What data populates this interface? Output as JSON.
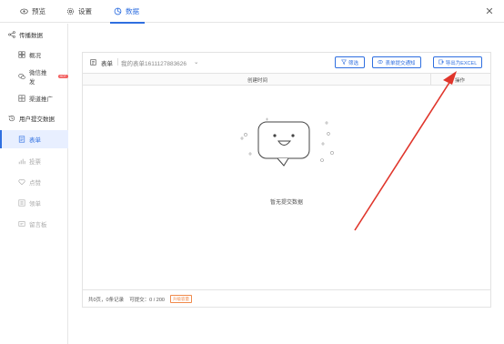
{
  "tabs": [
    {
      "label": "预览",
      "icon": "eye-icon"
    },
    {
      "label": "设置",
      "icon": "gear-icon"
    },
    {
      "label": "数据",
      "icon": "data-icon",
      "active": true
    }
  ],
  "sidebar": {
    "groups": [
      {
        "label": "传播数据",
        "icon": "share-icon",
        "items": [
          {
            "label": "概况",
            "icon": "grid-icon"
          },
          {
            "label": "微信推发",
            "icon": "wechat-icon",
            "badge": "HOT"
          },
          {
            "label": "渠道推广",
            "icon": "channel-icon"
          }
        ]
      },
      {
        "label": "用户提交数据",
        "icon": "history-icon",
        "items": [
          {
            "label": "表单",
            "icon": "form-icon",
            "active": true
          },
          {
            "label": "投票",
            "icon": "bar-icon",
            "muted": true
          },
          {
            "label": "点赞",
            "icon": "heart-icon",
            "muted": true
          },
          {
            "label": "领单",
            "icon": "list-icon",
            "muted": true
          },
          {
            "label": "留言板",
            "icon": "message-icon",
            "muted": true
          }
        ]
      }
    ]
  },
  "main": {
    "form_label": "表单",
    "form_name": "我的表单1611127883626",
    "buttons": {
      "filter": "筛选",
      "notify": "表单提交通知",
      "export": "导出为EXCEL"
    },
    "columns": [
      "创建时间",
      "操作"
    ],
    "empty_text": "暂无提交数据",
    "footer": {
      "pages": "共0页，0条记录",
      "quota": "可提交：0 / 200",
      "upgrade": "升级容量"
    }
  },
  "colors": {
    "accent": "#2f6fe0",
    "arrow": "#e0352b",
    "upgrade": "#f08a4b"
  }
}
